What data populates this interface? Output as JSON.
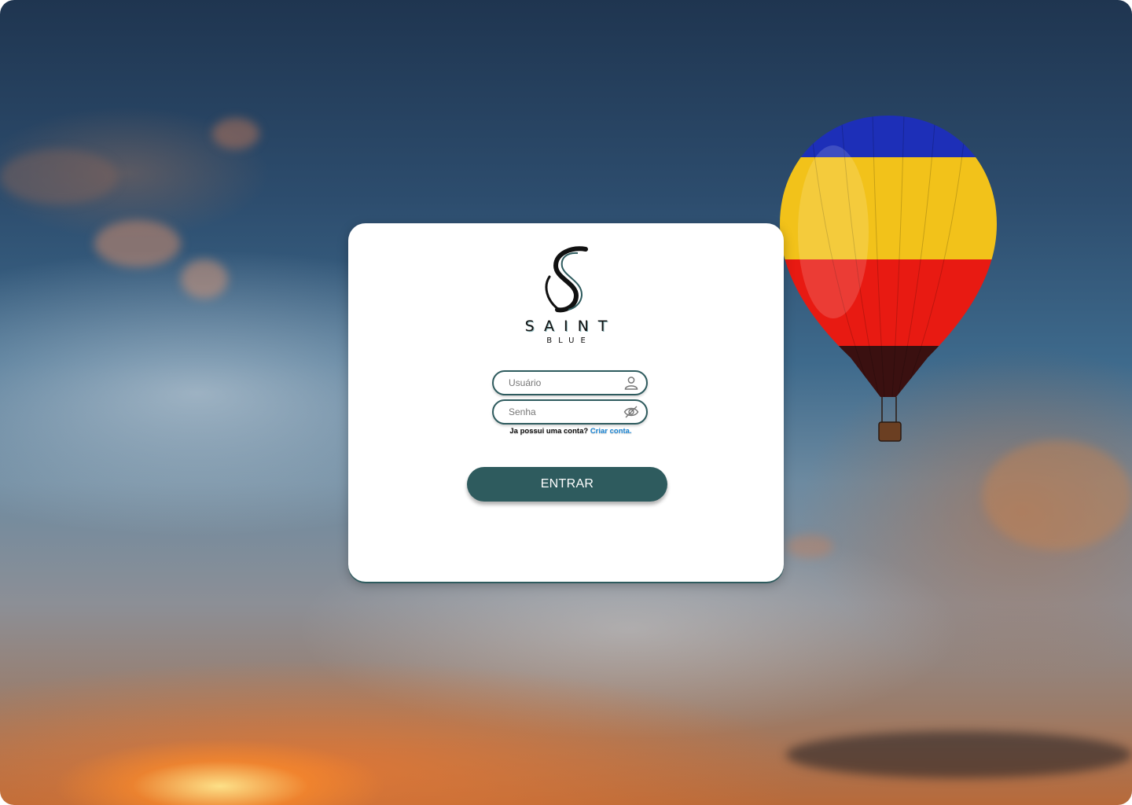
{
  "brand": {
    "name": "SAINT",
    "sub": "BLUE"
  },
  "login": {
    "username_placeholder": "Usuário",
    "password_placeholder": "Senha",
    "signup_prompt": "Ja possui uma conta?",
    "signup_link": "Criar conta.",
    "submit_label": "ENTRAR"
  },
  "icons": {
    "username": "user-icon",
    "password": "eye-off-icon",
    "background_object": "hot-air-balloon"
  },
  "colors": {
    "accent": "#2e5b5e",
    "link": "#1e88d6",
    "card": "#ffffff"
  }
}
